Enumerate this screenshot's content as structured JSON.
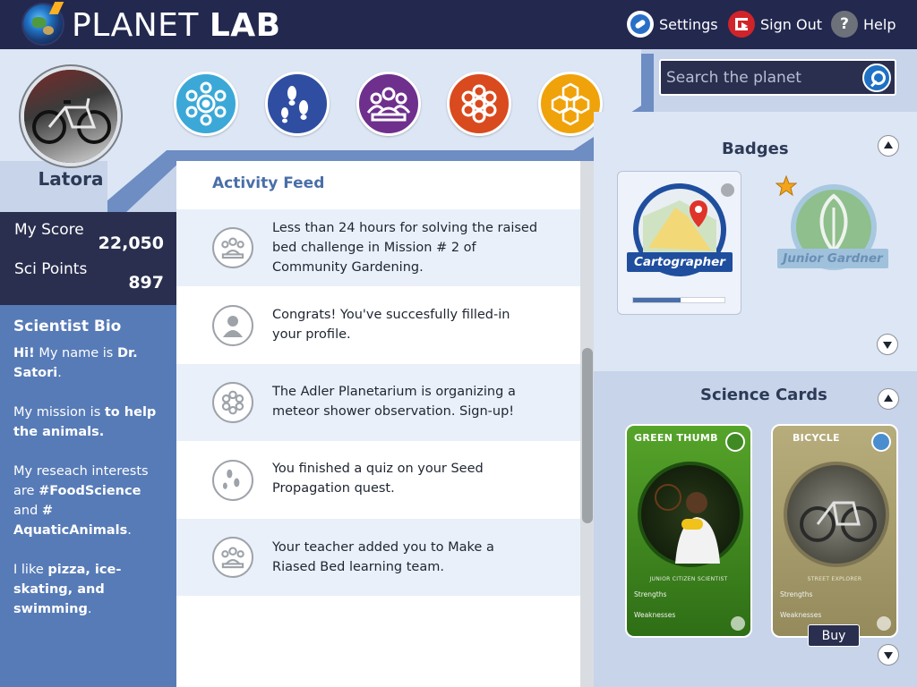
{
  "app": {
    "title_part1": "PLANET",
    "title_part2": "LAB"
  },
  "top_nav": {
    "settings": "Settings",
    "sign_out": "Sign Out",
    "help": "Help",
    "help_glyph": "?"
  },
  "user": {
    "name": "Latora"
  },
  "nav_circles": [
    {
      "icon": "network-eye-icon",
      "color": "#3ba8d8"
    },
    {
      "icon": "footprints-icon",
      "color": "#2f4ea2"
    },
    {
      "icon": "group-icon",
      "color": "#6e2f8d"
    },
    {
      "icon": "flower-icon",
      "color": "#d94a1e"
    },
    {
      "icon": "honeycomb-icon",
      "color": "#f0a20a"
    }
  ],
  "search": {
    "placeholder": "Search the planet"
  },
  "scores": [
    {
      "label": "My Score",
      "value": "22,050"
    },
    {
      "label": "Sci Points",
      "value": "897"
    }
  ],
  "bio": {
    "title": "Scientist Bio",
    "p1_bold1": "Hi!",
    "p1_text1": " My name is ",
    "p1_bold2": "Dr. Satori",
    "p1_text2": ".",
    "p2_text1": "My mission is ",
    "p2_bold1": "to help the animals.",
    "p3_text1": "My reseach interests are ",
    "p3_bold1": "#FoodScience",
    "p3_text2": " and ",
    "p3_bold2": "# AquaticAnimals",
    "p3_text3": ".",
    "p4_text1": "I like ",
    "p4_bold1": "pizza, ice-skating, and swimming",
    "p4_text2": "."
  },
  "feed": {
    "title": "Activity Feed",
    "items": [
      {
        "icon": "group-icon",
        "text": "Less than 24 hours for solving the raised bed challenge in Mission # 2 of Community Gardening."
      },
      {
        "icon": "profile-icon",
        "text": "Congrats! You've succesfully filled-in your profile."
      },
      {
        "icon": "flower-icon",
        "text": "The Adler Planetarium is organizing a meteor shower observation. Sign-up!"
      },
      {
        "icon": "footprints-icon",
        "text": "You finished a quiz on your Seed Propagation quest."
      },
      {
        "icon": "group-icon",
        "text": "Your teacher added you to Make a Riased Bed learning team."
      }
    ]
  },
  "badges": {
    "title": "Badges",
    "items": [
      {
        "name": "Cartographer",
        "progress": 0.52
      },
      {
        "name": "Junior Gardner",
        "starred": true
      }
    ]
  },
  "science_cards": {
    "title": "Science Cards",
    "cards": [
      {
        "name": "GREEN THUMB",
        "subtitle": "JUNIOR CITIZEN SCIENTIST",
        "strengths": "Strengths",
        "weaknesses": "Weaknesses",
        "color": "#3f8a22"
      },
      {
        "name": "BICYCLE",
        "subtitle": "STREET EXPLORER",
        "strengths": "Strengths",
        "weaknesses": "Weaknesses",
        "color": "#a79b6e"
      }
    ],
    "buy_label": "Buy"
  }
}
